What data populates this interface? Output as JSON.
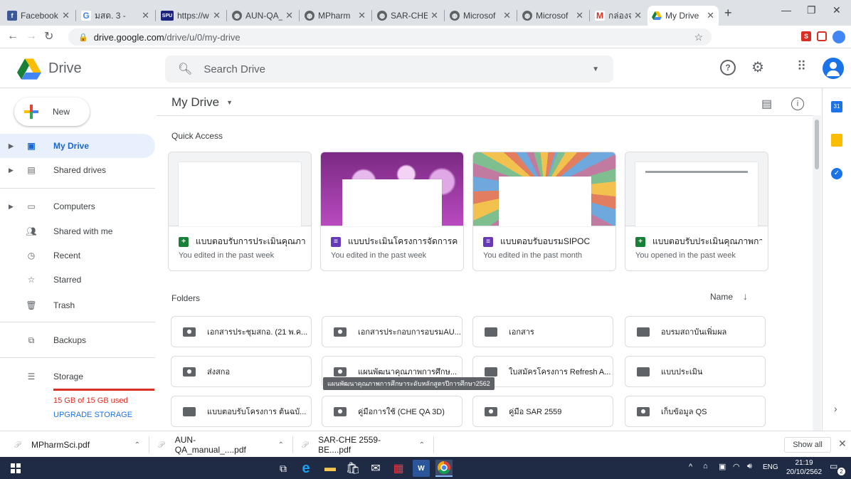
{
  "browser": {
    "tabs": [
      {
        "title": "Facebook",
        "favicon": "F",
        "favicon_color": "#3b5998"
      },
      {
        "title": "มสด. 3 - ",
        "favicon": "G",
        "favicon_color": "#4285f4"
      },
      {
        "title": "https://w",
        "favicon": "SPU",
        "favicon_color": "#1a237e"
      },
      {
        "title": "AUN-QA_",
        "favicon": "globe",
        "favicon_color": "#5f6368"
      },
      {
        "title": "MPharm",
        "favicon": "globe",
        "favicon_color": "#5f6368"
      },
      {
        "title": "SAR-CHE",
        "favicon": "globe",
        "favicon_color": "#5f6368"
      },
      {
        "title": "Microsof",
        "favicon": "globe",
        "favicon_color": "#5f6368"
      },
      {
        "title": "Microsof",
        "favicon": "globe",
        "favicon_color": "#5f6368"
      },
      {
        "title": "กล่องจดหม",
        "favicon": "M",
        "favicon_color": "#d93025"
      },
      {
        "title": "My Drive",
        "favicon": "drive",
        "favicon_color": "#188038"
      }
    ],
    "new_tab_label": "+",
    "url_host": "drive.google.com",
    "url_path": "/drive/u/0/my-drive"
  },
  "drive": {
    "logo_text": "Drive",
    "search_placeholder": "Search Drive",
    "new_button": "New",
    "sidebar": [
      {
        "label": "My Drive",
        "icon": "my-drive-icon",
        "selected": true
      },
      {
        "label": "Shared drives",
        "icon": "shared-drives-icon"
      },
      {
        "label": "Computers",
        "icon": "computers-icon"
      },
      {
        "label": "Shared with me",
        "icon": "shared-with-me-icon"
      },
      {
        "label": "Recent",
        "icon": "recent-icon"
      },
      {
        "label": "Starred",
        "icon": "starred-icon"
      },
      {
        "label": "Trash",
        "icon": "trash-icon"
      },
      {
        "label": "Backups",
        "icon": "backups-icon"
      },
      {
        "label": "Storage",
        "icon": "storage-icon"
      }
    ],
    "storage_used": "15 GB of 15 GB used",
    "upgrade_label": "UPGRADE STORAGE",
    "page_title": "My Drive",
    "quick_access_label": "Quick Access",
    "quick_access": [
      {
        "name": "แบบตอบรับการประเมินคุณภา...",
        "type": "sheets",
        "sub": "You edited in the past week"
      },
      {
        "name": "แบบประเมินโครงการจัดการคว...",
        "type": "forms",
        "sub": "You edited in the past week"
      },
      {
        "name": "แบบตอบรับอบรมSIPOC",
        "type": "forms",
        "sub": "You edited in the past month"
      },
      {
        "name": "แบบตอบรับประเมินคุณภาพกา...",
        "type": "sheets",
        "sub": "You opened in the past week"
      }
    ],
    "folders_label": "Folders",
    "sort_label": "Name",
    "folders": [
      {
        "name": "เอกสารประชุมสกอ. (21 พ.ค...",
        "shared": true
      },
      {
        "name": "เอกสารประกอบการอบรมAU...",
        "shared": true
      },
      {
        "name": "เอกสาร",
        "shared": false
      },
      {
        "name": "อบรมสถาบันเพิ่มผล",
        "shared": false
      },
      {
        "name": "ส่งสกอ",
        "shared": true
      },
      {
        "name": "แผนพัฒนาคุณภาพการศึกษ...",
        "shared": true
      },
      {
        "name": "ใบสมัครโครงการ Refresh A...",
        "shared": false
      },
      {
        "name": "แบบประเมิน",
        "shared": false
      },
      {
        "name": "แบบตอบรับโครงการ ต้นฉบั...",
        "shared": false
      },
      {
        "name": "คู่มือการใช้ (CHE QA 3D)",
        "shared": true
      },
      {
        "name": "คู่มือ SAR 2559",
        "shared": true
      },
      {
        "name": "เก็บข้อมูล QS",
        "shared": true
      }
    ],
    "tooltip": "แผนพัฒนาคุณภาพการศึกษาระดับหลักสูตรปีการศึกษา2562"
  },
  "downloads": [
    {
      "name": "MPharmSci.pdf"
    },
    {
      "name": "AUN-QA_manual_....pdf"
    },
    {
      "name": "SAR-CHE 2559-BE....pdf"
    }
  ],
  "downloads_show_all": "Show all",
  "taskbar": {
    "language": "ENG",
    "time": "21:19",
    "date": "20/10/2562",
    "notification_count": "2"
  }
}
